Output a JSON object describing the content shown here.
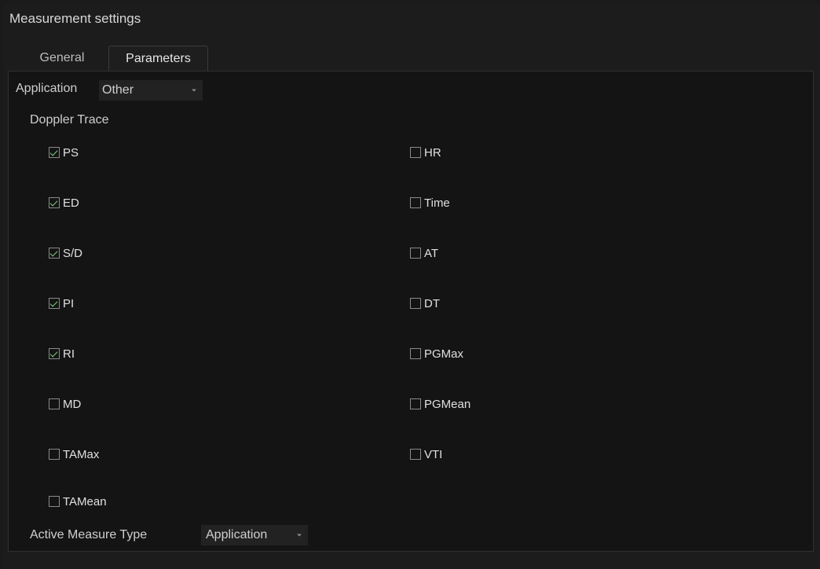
{
  "window": {
    "title": "Measurement settings"
  },
  "tabs": [
    {
      "label": "General",
      "active": false
    },
    {
      "label": "Parameters",
      "active": true
    }
  ],
  "application": {
    "label": "Application",
    "value": "Other"
  },
  "section": {
    "title": "Doppler Trace"
  },
  "left_params": [
    {
      "label": "PS",
      "checked": true
    },
    {
      "label": "ED",
      "checked": true
    },
    {
      "label": "S/D",
      "checked": true
    },
    {
      "label": "PI",
      "checked": true
    },
    {
      "label": "RI",
      "checked": true
    },
    {
      "label": "MD",
      "checked": false
    },
    {
      "label": "TAMax",
      "checked": false
    },
    {
      "label": "TAMean",
      "checked": false
    }
  ],
  "right_params": [
    {
      "label": "HR",
      "checked": false
    },
    {
      "label": "Time",
      "checked": false
    },
    {
      "label": "AT",
      "checked": false
    },
    {
      "label": "DT",
      "checked": false
    },
    {
      "label": "PGMax",
      "checked": false
    },
    {
      "label": "PGMean",
      "checked": false
    },
    {
      "label": "VTI",
      "checked": false
    }
  ],
  "active_measure": {
    "label": "Active Measure Type",
    "value": "Application"
  },
  "colors": {
    "background": "#141414",
    "check_accent": "#7fcf7f",
    "text": "#e0e0e0"
  }
}
